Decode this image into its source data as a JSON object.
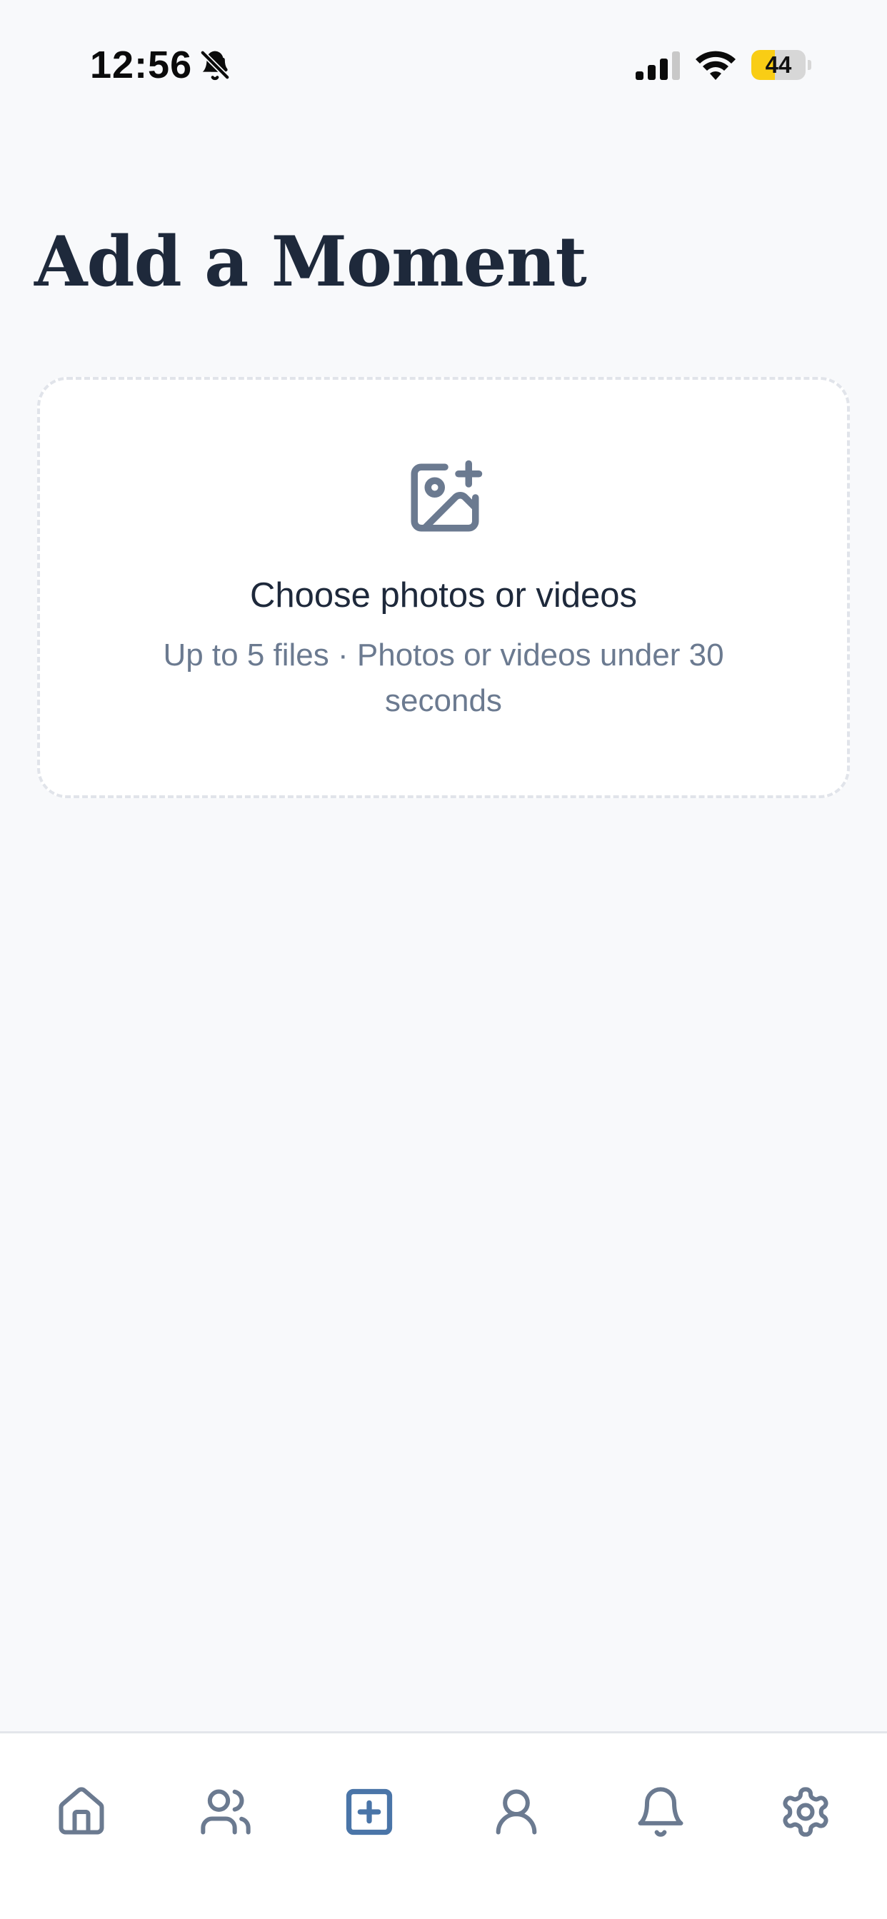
{
  "status_bar": {
    "time": "12:56",
    "battery_level": 44,
    "battery_label": "44",
    "icons": [
      "bell-off-icon",
      "cellular-signal-icon",
      "wifi-icon",
      "battery-icon"
    ]
  },
  "page": {
    "title": "Add a Moment"
  },
  "upload": {
    "icon": "image-plus-icon",
    "title": "Choose photos or videos",
    "subtitle": "Up to 5 files · Photos or videos under 30 seconds"
  },
  "tab_bar": {
    "active": "create",
    "items": [
      {
        "id": "home",
        "icon": "home-icon"
      },
      {
        "id": "friends",
        "icon": "users-icon"
      },
      {
        "id": "create",
        "icon": "plus-square-icon"
      },
      {
        "id": "profile",
        "icon": "user-icon"
      },
      {
        "id": "notifications",
        "icon": "bell-icon"
      },
      {
        "id": "settings",
        "icon": "gear-icon"
      }
    ]
  },
  "colors": {
    "background": "#f8f9fb",
    "title": "#1e293b",
    "muted": "#6b7a90",
    "icon_inactive": "#6b7a90",
    "icon_active": "#4a75a8",
    "dashed_border": "#e1e4ea",
    "battery": "#f9cd15"
  }
}
